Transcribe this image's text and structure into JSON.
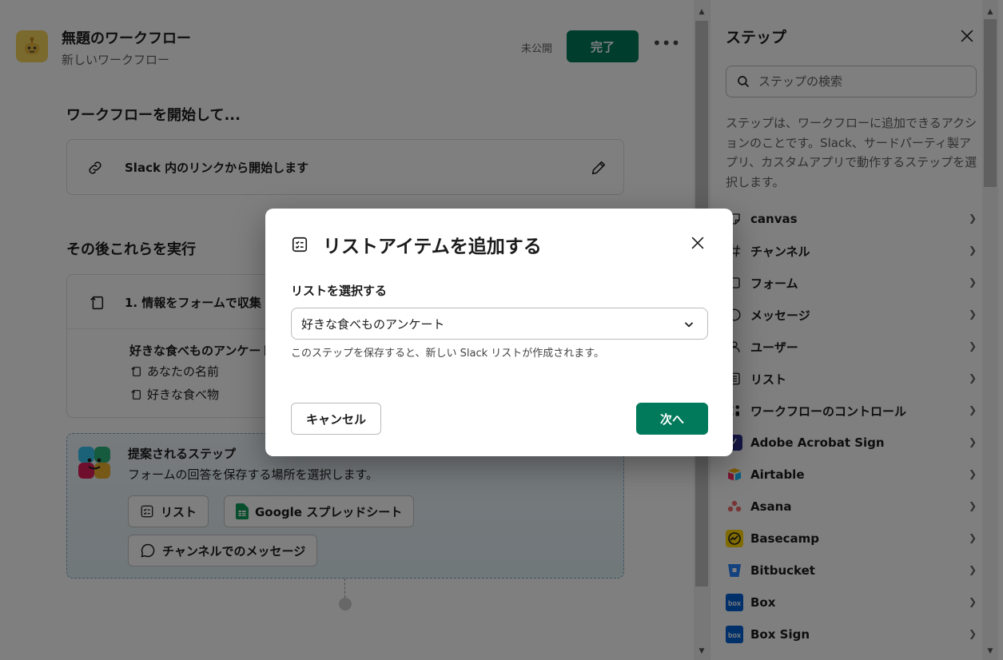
{
  "workflow": {
    "title": "無題のワークフロー",
    "subtitle": "新しいワークフロー",
    "status": "未公開",
    "done_label": "完了",
    "more_label": "•••"
  },
  "start_section": {
    "title": "ワークフローを開始して...",
    "trigger_text": "Slack 内のリンクから開始します"
  },
  "then_section": {
    "title": "その後これらを実行",
    "step_title": "1. 情報をフォームで収集",
    "form_name": "好きな食べものアンケート",
    "fields": [
      "あなたの名前",
      "好きな食べ物"
    ]
  },
  "suggest": {
    "title": "提案されるステップ",
    "description": "フォームの回答を保存する場所を選択します。",
    "chips": [
      "リスト",
      "Google スプレッドシート",
      "チャンネルでのメッセージ"
    ]
  },
  "panel": {
    "title": "ステップ",
    "search_placeholder": "ステップの検索",
    "description": "ステップは、ワークフローに追加できるアクションのことです。Slack、サードパーティ製アプリ、カスタムアプリで動作するステップを選択します。",
    "items": [
      {
        "label": "canvas",
        "icon": "canvas-icon"
      },
      {
        "label": "チャンネル",
        "icon": "hash-icon"
      },
      {
        "label": "フォーム",
        "icon": "form-icon"
      },
      {
        "label": "メッセージ",
        "icon": "message-icon"
      },
      {
        "label": "ユーザー",
        "icon": "user-icon"
      },
      {
        "label": "リスト",
        "icon": "list-icon"
      },
      {
        "label": "ワークフローのコントロール",
        "icon": "workflow-control-icon"
      },
      {
        "label": "Adobe Acrobat Sign",
        "icon": "adobe-acrobat-sign-icon"
      },
      {
        "label": "Airtable",
        "icon": "airtable-icon"
      },
      {
        "label": "Asana",
        "icon": "asana-icon"
      },
      {
        "label": "Basecamp",
        "icon": "basecamp-icon"
      },
      {
        "label": "Bitbucket",
        "icon": "bitbucket-icon"
      },
      {
        "label": "Box",
        "icon": "box-icon"
      },
      {
        "label": "Box Sign",
        "icon": "box-sign-icon"
      }
    ]
  },
  "modal": {
    "title": "リストアイテムを追加する",
    "select_label": "リストを選択する",
    "selected_value": "好きな食べものアンケート",
    "hint": "このステップを保存すると、新しい Slack リストが作成されます。",
    "cancel_label": "キャンセル",
    "next_label": "次へ"
  },
  "colors": {
    "primary_green": "#007a5a",
    "overlay": "rgba(0,0,0,0.5)"
  }
}
